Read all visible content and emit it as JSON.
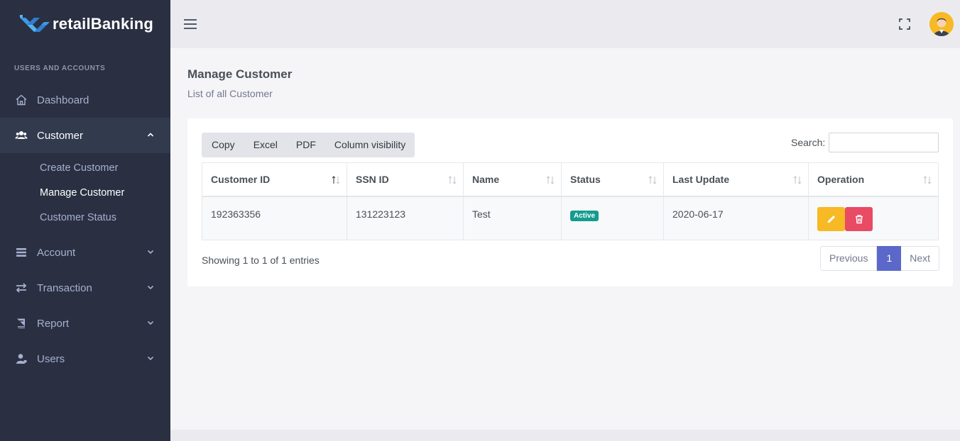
{
  "brand": {
    "name": "retailBanking"
  },
  "sidebar": {
    "section_title": "USERS AND ACCOUNTS",
    "items": [
      {
        "label": "Dashboard",
        "icon": "home-icon"
      },
      {
        "label": "Customer",
        "icon": "users-icon",
        "sub": [
          "Create Customer",
          "Manage Customer",
          "Customer Status"
        ]
      },
      {
        "label": "Account",
        "icon": "list-icon"
      },
      {
        "label": "Transaction",
        "icon": "exchange-icon"
      },
      {
        "label": "Report",
        "icon": "book-icon"
      },
      {
        "label": "Users",
        "icon": "user-icon"
      }
    ]
  },
  "page": {
    "title": "Manage Customer",
    "subtitle": "List of all Customer"
  },
  "toolbar": {
    "buttons": [
      "Copy",
      "Excel",
      "PDF",
      "Column visibility"
    ],
    "search_label": "Search:"
  },
  "table": {
    "columns": [
      "Customer ID",
      "SSN ID",
      "Name",
      "Status",
      "Last Update",
      "Operation"
    ],
    "rows": [
      {
        "customer_id": "192363356",
        "ssn_id": "131223123",
        "name": "Test",
        "status": "Active",
        "last_update": "2020-06-17"
      }
    ]
  },
  "footer_info": "Showing 1 to 1 of 1 entries",
  "pagination": {
    "previous": "Previous",
    "current": "1",
    "next": "Next"
  },
  "colors": {
    "sidebar": "#2a3042",
    "accent": "#5b68c9",
    "edit": "#f7b924",
    "delete": "#e94a64",
    "active_badge": "#149c8e"
  }
}
